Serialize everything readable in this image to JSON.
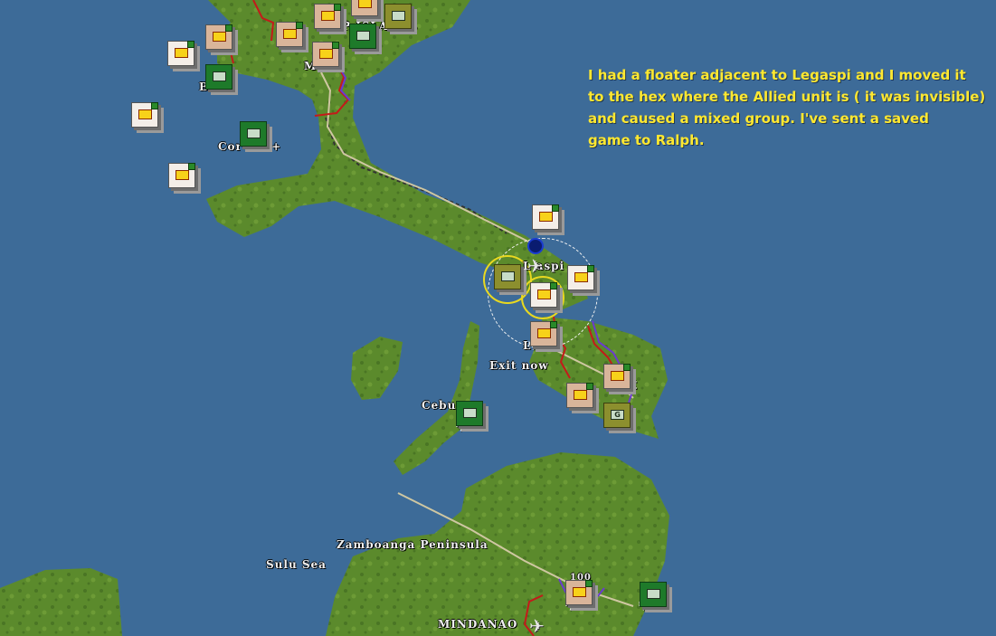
{
  "map": {
    "colors": {
      "sea": "#3d6b98",
      "land": "#5b8a2c",
      "land_dark": "#4a7524",
      "road": "#c8c2a0",
      "rail": "#333333",
      "border_red": "#c41a1a",
      "border_purple": "#6a3ad0",
      "note_text": "#ffe830"
    },
    "labels": {
      "philippine_islands": "P      ISLANDS",
      "bataan": "B     n",
      "corregidor": "Cor        lor +",
      "legaspi": "L   aspi",
      "leyte_fragment": "L       +",
      "exit_now": "Exit now",
      "cebu": "Cebu",
      "samar_fragment": "E",
      "zamboanga": "Zamboanga Peninsula",
      "sulu_sea": "Sulu Sea",
      "mindanao": "MINDANAO",
      "manila_fragment": "M      +",
      "hundred": "100"
    }
  },
  "note": {
    "lines": [
      "I had a floater adjacent to Legaspi and I moved it",
      "to the hex where the Allied unit is ( it was invisible)",
      "and caused a mixed group.  I've sent a saved",
      "game to Ralph."
    ]
  },
  "units": [
    {
      "id": "jp-air-bataan-nw",
      "kind": "jp",
      "icon": "aircraft-icon"
    },
    {
      "id": "jp-air-west-1",
      "kind": "jp",
      "icon": "aircraft-icon"
    },
    {
      "id": "jp-air-west-2",
      "kind": "jp",
      "icon": "aircraft-icon"
    },
    {
      "id": "jp-inf-north",
      "kind": "jpt",
      "icon": "infantry-icon"
    },
    {
      "id": "jp-air-north",
      "kind": "jpt",
      "icon": "aircraft-icon"
    },
    {
      "id": "jp-inf-north-2",
      "kind": "jpt",
      "icon": "infantry-icon"
    },
    {
      "id": "jp-inf-north-3",
      "kind": "jpt",
      "icon": "infantry-icon"
    },
    {
      "id": "al-inf-north",
      "kind": "al",
      "icon": "infantry-icon"
    },
    {
      "id": "al-armor-north",
      "kind": "ol",
      "icon": "armor-icon"
    },
    {
      "id": "al-fort-bataan",
      "kind": "al",
      "icon": "fort-icon"
    },
    {
      "id": "al-inf-corregidor",
      "kind": "al",
      "icon": "infantry-icon"
    },
    {
      "id": "jp-ship-legaspi",
      "kind": "jp",
      "icon": "ship-icon"
    },
    {
      "id": "al-inf-legaspi",
      "kind": "ol",
      "icon": "infantry-icon"
    },
    {
      "id": "jp-air-legaspi",
      "kind": "jp",
      "icon": "aircraft-icon"
    },
    {
      "id": "jp-ship-legaspi-2",
      "kind": "jp",
      "icon": "ship-icon"
    },
    {
      "id": "jp-inf-leyte",
      "kind": "jpt",
      "icon": "infantry-icon"
    },
    {
      "id": "jp-inf-samar-1",
      "kind": "jpt",
      "icon": "infantry-icon"
    },
    {
      "id": "jp-inf-samar-2",
      "kind": "jpt",
      "icon": "infantry-icon"
    },
    {
      "id": "al-guerrilla-samar",
      "kind": "ol",
      "icon": "guerrilla-icon",
      "text": "G"
    },
    {
      "id": "al-air-cebu",
      "kind": "al",
      "icon": "aircraft-icon"
    },
    {
      "id": "jp-air-mindanao",
      "kind": "jpt",
      "icon": "aircraft-icon"
    },
    {
      "id": "al-air-mindanao",
      "kind": "al",
      "icon": "aircraft-icon"
    }
  ]
}
